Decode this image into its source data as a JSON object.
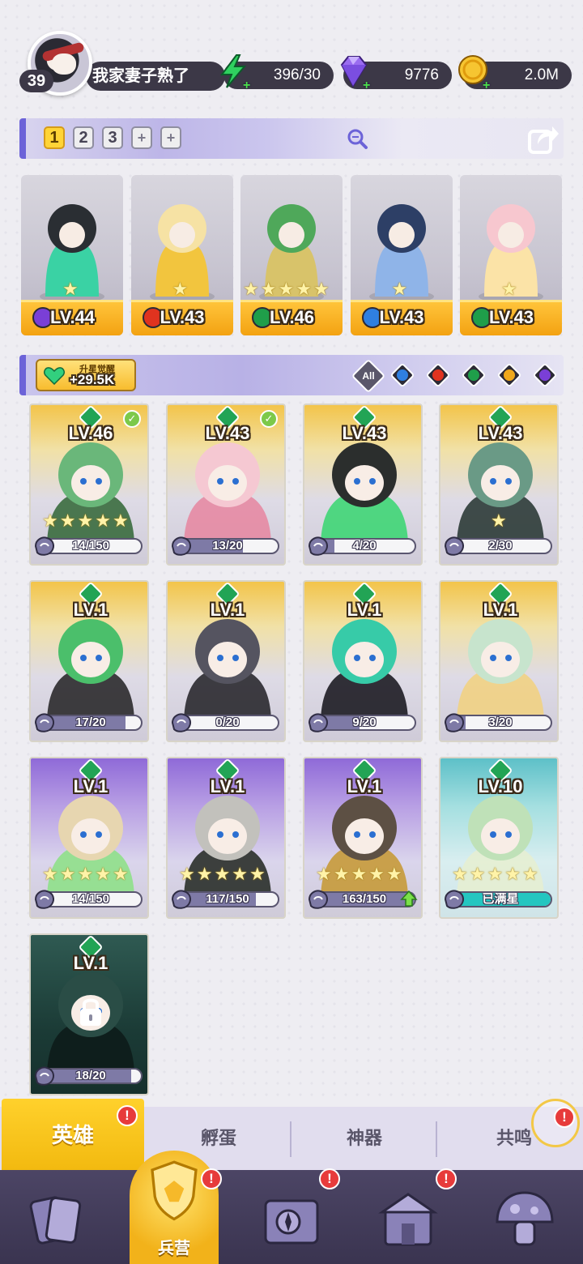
{
  "player": {
    "level": "39",
    "name": "我家妻子熟了"
  },
  "resources": {
    "energy": "396/30",
    "gems": "9776",
    "gold": "2.0M"
  },
  "team_tabs": [
    "1",
    "2",
    "3"
  ],
  "team_add_labels": [
    "+",
    "+"
  ],
  "team": [
    {
      "level": "LV.44",
      "element": "dark",
      "stars": 1
    },
    {
      "level": "LV.43",
      "element": "fire",
      "stars": 1
    },
    {
      "level": "LV.46",
      "element": "nature",
      "stars": 5
    },
    {
      "level": "LV.43",
      "element": "water",
      "stars": 1
    },
    {
      "level": "LV.43",
      "element": "nature",
      "stars": 1
    }
  ],
  "awaken": {
    "title": "升星觉醒",
    "value": "+29.5K"
  },
  "filters": {
    "all_label": "All",
    "elements": [
      "water",
      "fire",
      "nature",
      "light",
      "dark"
    ],
    "colors": {
      "water": "#2f7fe0",
      "fire": "#e0331f",
      "nature": "#1f9e4a",
      "light": "#f0a81a",
      "dark": "#7a3fd6"
    }
  },
  "heroes": [
    {
      "level": "LV.46",
      "shards": "14/150",
      "progress": 0.09,
      "stars": 5,
      "rarity": "gold",
      "checked": true
    },
    {
      "level": "LV.43",
      "shards": "13/20",
      "progress": 0.65,
      "stars": 0,
      "rarity": "gold",
      "checked": true
    },
    {
      "level": "LV.43",
      "shards": "4/20",
      "progress": 0.2,
      "stars": 0,
      "rarity": "gold",
      "checked": false
    },
    {
      "level": "LV.43",
      "shards": "2/30",
      "progress": 0.07,
      "stars": 1,
      "rarity": "gold",
      "checked": false
    },
    {
      "level": "LV.1",
      "shards": "17/20",
      "progress": 0.85,
      "stars": 0,
      "rarity": "gold",
      "checked": false
    },
    {
      "level": "LV.1",
      "shards": "0/20",
      "progress": 0,
      "stars": 0,
      "rarity": "gold",
      "checked": false
    },
    {
      "level": "LV.1",
      "shards": "9/20",
      "progress": 0.45,
      "stars": 0,
      "rarity": "gold",
      "checked": false
    },
    {
      "level": "LV.1",
      "shards": "3/20",
      "progress": 0.15,
      "stars": 0,
      "rarity": "gold",
      "checked": false
    },
    {
      "level": "LV.1",
      "shards": "14/150",
      "progress": 0.09,
      "stars": 5,
      "rarity": "purple",
      "checked": false
    },
    {
      "level": "LV.1",
      "shards": "117/150",
      "progress": 0.78,
      "stars": 5,
      "rarity": "purple",
      "checked": false
    },
    {
      "level": "LV.1",
      "shards": "163/150",
      "progress": 1,
      "stars": 5,
      "rarity": "purple",
      "checked": false,
      "upgradable": true
    },
    {
      "level": "LV.10",
      "shards": "已满星",
      "progress": 1,
      "stars": 5,
      "rarity": "teal",
      "checked": false
    },
    {
      "level": "LV.1",
      "shards": "18/20",
      "progress": 0.9,
      "stars": 0,
      "rarity": "locked",
      "checked": false,
      "locked": true
    }
  ],
  "subtabs": {
    "active": "英雄",
    "items": [
      "孵蛋",
      "神器",
      "共鸣"
    ]
  },
  "bottom_nav": {
    "active_label": "兵营"
  },
  "badges": {
    "alert": "!"
  },
  "hero_art_colors": [
    [
      "#6ab77a",
      "#3a6b3e"
    ],
    [
      "#f5c8d2",
      "#e58aa3"
    ],
    [
      "#2b2e2d",
      "#3fd675"
    ],
    [
      "#6a9a86",
      "#2c3b37"
    ],
    [
      "#4bbf6b",
      "#2b2a2c"
    ],
    [
      "#555460",
      "#2a292f"
    ],
    [
      "#37cba8",
      "#1d1c24"
    ],
    [
      "#c7e4cd",
      "#f1d283"
    ],
    [
      "#e7d6b0",
      "#8fe08a"
    ],
    [
      "#c2c1bc",
      "#2a2f2a"
    ],
    [
      "#5d5044",
      "#c79a3a"
    ],
    [
      "#bfe1b8",
      "#e6eed2"
    ],
    [
      "#2a4d46",
      "#0d1c1a"
    ]
  ],
  "team_art_colors": [
    [
      "#2a2e33",
      "#3ad2a4"
    ],
    [
      "#f6e2a4",
      "#f2c53e"
    ],
    [
      "#4fa85a",
      "#d8c36a"
    ],
    [
      "#2d3f66",
      "#8fb4e8"
    ],
    [
      "#f7c7cf",
      "#fbe3a7"
    ]
  ]
}
